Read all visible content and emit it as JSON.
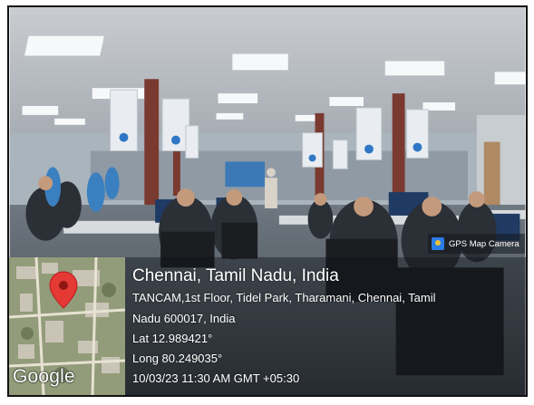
{
  "stamp": {
    "badge_label": "GPS Map Camera",
    "location_title": "Chennai, Tamil Nadu, India",
    "address_line1": "TANCAM,1st Floor, Tidel Park, Tharamani, Chennai, Tamil",
    "address_line2": "Nadu 600017, India",
    "latitude": "Lat 12.989421°",
    "longitude": "Long 80.249035°",
    "datetime": "10/03/23 11:30 AM GMT +05:30"
  },
  "map": {
    "attribution": "Google",
    "pin_color": "#e53935"
  },
  "photo": {
    "icon": "photo-scene"
  }
}
